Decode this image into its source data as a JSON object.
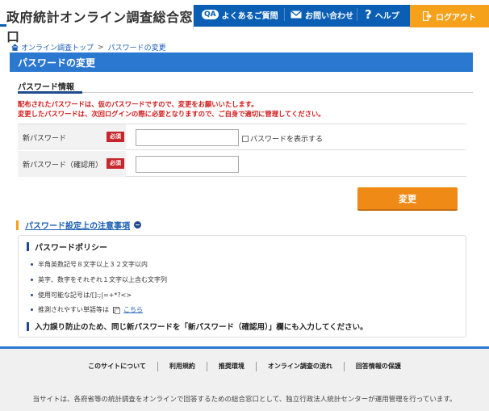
{
  "header": {
    "site_title": "政府統計オンライン調査総合窓口",
    "faq_icon": "QA",
    "faq_label": "よくあるご質問",
    "contact_label": "お問い合わせ",
    "help_label": "ヘルプ",
    "logout_label": "ログアウト"
  },
  "breadcrumb": {
    "home": "オンライン調査トップ",
    "separator": ">",
    "current": "パスワードの変更"
  },
  "page_title": "パスワードの変更",
  "section_heading": "パスワード情報",
  "notice": {
    "line1": "配布されたパスワードは、仮のパスワードですので、変更をお願いいたします。",
    "line2": "変更したパスワードは、次回ログインの際に必要となりますので、ご自身で適切に管理してください。"
  },
  "form": {
    "new_password_label": "新パスワード",
    "confirm_password_label": "新パスワード（確認用）",
    "required_badge": "必須",
    "new_password_value": "",
    "confirm_password_value": "",
    "show_password_label": "パスワードを表示する"
  },
  "change_button": "変更",
  "notes_link": "パスワード設定上の注意事項",
  "policy": {
    "title": "パスワードポリシー",
    "items": [
      "半角英数記号８文字以上３２文字以内",
      "英字、数字をそれぞれ１文字以上含む文字列",
      "使用可能な記号は/[]:;|=+*?<>",
      "推測されやすい単語等は"
    ],
    "link_label": "こちら",
    "warning": "入力誤り防止のため、同じ新パスワードを「新パスワード（確認用）」欄にも入力してください。"
  },
  "footer": {
    "nav": [
      "このサイトについて",
      "利用規約",
      "推奨環境",
      "オンライン調査の流れ",
      "回答情報の保護"
    ],
    "note": "当サイトは、各府省等の統計調査をオンラインで回答するための総合窓口として、独立行政法人統計センターが運用管理を行っています。"
  },
  "colors": {
    "header_blue": "#0a5fb5",
    "accent_orange": "#f08a17",
    "notice_red": "#d01919",
    "title_bar_blue": "#2b78d0"
  }
}
